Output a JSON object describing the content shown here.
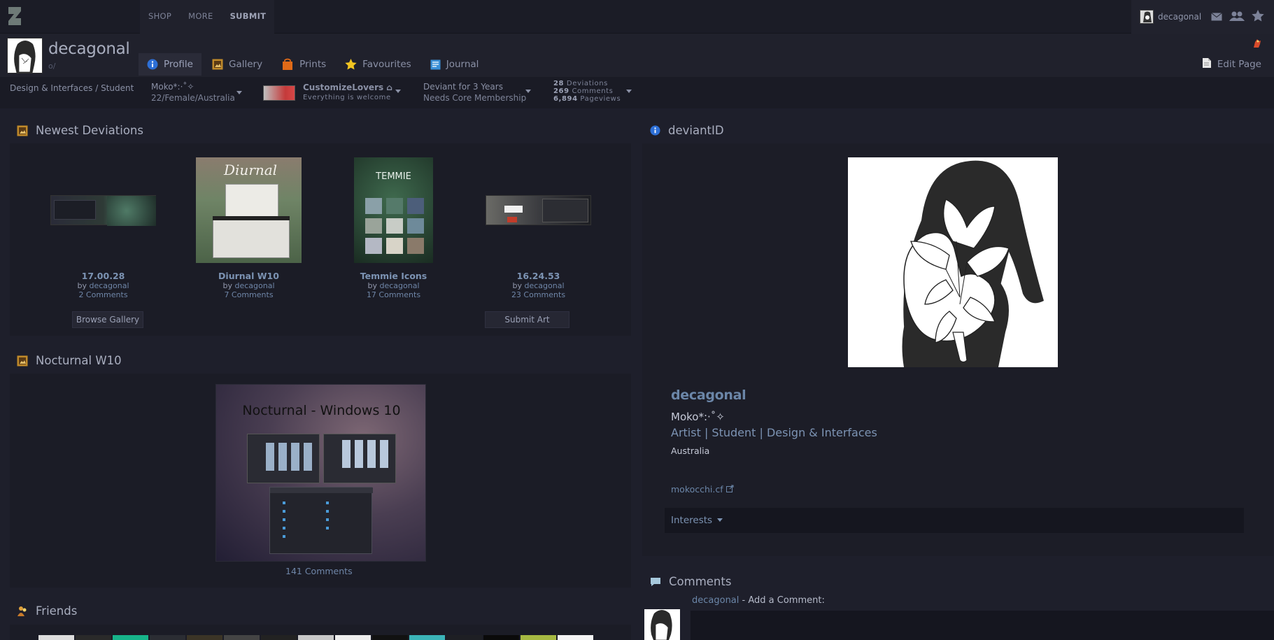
{
  "topbar": {
    "nav": [
      "SHOP",
      "MORE",
      "SUBMIT"
    ],
    "username": "decagonal"
  },
  "profile": {
    "name": "decagonal",
    "tagline": "o/",
    "tabs": [
      "Profile",
      "Gallery",
      "Prints",
      "Favourites",
      "Journal"
    ],
    "edit_page": "Edit Page"
  },
  "infobar": {
    "category": "Design & Interfaces / Student",
    "moko_line1": "Moko*:·˚✧",
    "moko_line2": "22/Female/Australia",
    "group_name": "CustomizeLovers",
    "group_tag": "Everything is welcome",
    "deviant_line1": "Deviant for 3 Years",
    "deviant_line2": "Needs Core Membership",
    "stats": [
      {
        "num": "28",
        "label": "Deviations"
      },
      {
        "num": "269",
        "label": "Comments"
      },
      {
        "num": "6,894",
        "label": "Pageviews"
      }
    ]
  },
  "newest": {
    "title": "Newest Deviations",
    "items": [
      {
        "title": "17.00.28",
        "by": "by",
        "author": "decagonal",
        "comments": "2 Comments"
      },
      {
        "title": "Diurnal W10",
        "by": "by",
        "author": "decagonal",
        "comments": "7 Comments"
      },
      {
        "title": "Temmie Icons",
        "by": "by",
        "author": "decagonal",
        "comments": "17 Comments"
      },
      {
        "title": "16.24.53",
        "by": "by",
        "author": "decagonal",
        "comments": "23 Comments"
      }
    ],
    "browse": "Browse Gallery",
    "submit": "Submit Art"
  },
  "featured": {
    "title": "Nocturnal W10",
    "image_text": "Nocturnal - Windows 10",
    "comments": "141 Comments"
  },
  "friends": {
    "title": "Friends"
  },
  "deviantid": {
    "title": "deviantID",
    "name": "decagonal",
    "moko": "Moko*:·˚✧",
    "role": "Artist | Student | Design & Interfaces",
    "location": "Australia",
    "link": "mokocchi.cf",
    "interests": "Interests"
  },
  "comments": {
    "title": "Comments",
    "user": "decagonal",
    "prompt": " - Add a Comment:"
  },
  "thumbs_text": {
    "diurnal": "Diurnal",
    "temmie": "TEMMIE"
  },
  "colors": {
    "accent_link": "#6b86a8",
    "background": "#1e1f2b"
  }
}
